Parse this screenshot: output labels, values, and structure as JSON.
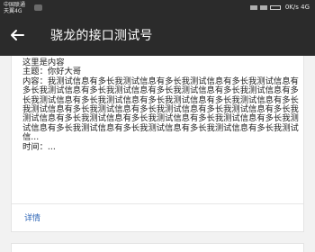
{
  "status_bar": {
    "carrier_line1": "中国联通",
    "carrier_line2": "天翼4G",
    "carrier_badge": "3G",
    "right": "0K/s 4G"
  },
  "app_bar": {
    "back_icon": "arrow-left",
    "title": "骁龙的接口测试号"
  },
  "message": {
    "intro": "这里是内容",
    "topic_label": "主题：",
    "topic_value": "你好大哥",
    "content_label": "内容：",
    "content_value": "我测试信息有多长我测试信息有多长我测试信息有多长我测试信息有多长我测试信息有多长我测试信息有多长我测试信息有多长我测试信息有多长我测试信息有多长我测试信息有多长我测试信息有多长我测试信息有多长我测试信息有多长我测试信息有多长我测试信息有多长我测试信息有多长我测试信息有多长我测试信息有多长我测试信息有多长我测试信息有多长我测试信息有多长我测试信息有多长我测试信息有多长我测试信息有多长我测试信...",
    "time_label": "时间：",
    "time_value": "..."
  },
  "actions": {
    "details_label": "详情"
  },
  "colors": {
    "bar_background": "#2b2b2b",
    "page_background": "#f2f2f2",
    "link": "#2c64b6"
  }
}
